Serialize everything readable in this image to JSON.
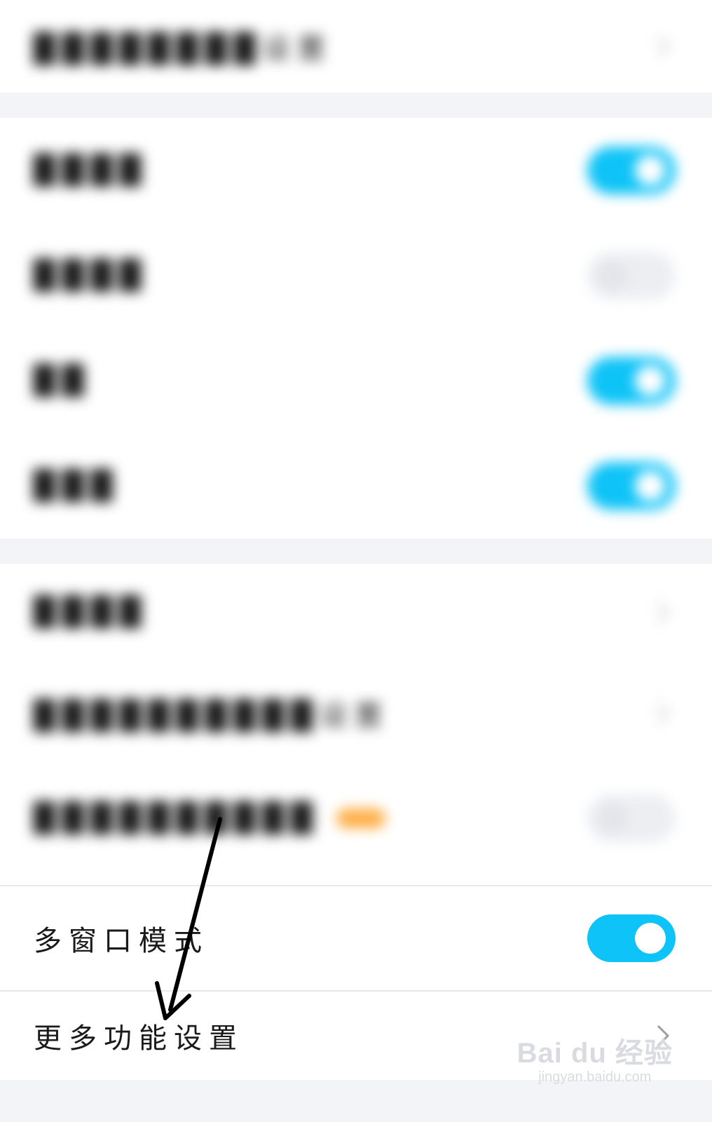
{
  "rows": {
    "blur_1": {
      "label": "████████设置"
    },
    "blur_2": {
      "label": "████"
    },
    "blur_3": {
      "label": "████"
    },
    "blur_4": {
      "label": "██"
    },
    "blur_5": {
      "label": "███"
    },
    "blur_6": {
      "label": "████"
    },
    "blur_7": {
      "label": "██████████设置"
    },
    "blur_8": {
      "label": "██████████"
    },
    "multi_window": {
      "label": "多窗口模式",
      "toggle": "on"
    },
    "more_settings": {
      "label": "更多功能设置"
    }
  },
  "colors": {
    "accent": "#0ec3f7",
    "badge": "#ffad45",
    "annotation": "#000000"
  },
  "icons": {
    "chevron": "chevron-right-icon",
    "annotation": "arrow-annotation"
  },
  "watermark": {
    "main": "Bai du 经验",
    "sub": "jingyan.baidu.com"
  }
}
